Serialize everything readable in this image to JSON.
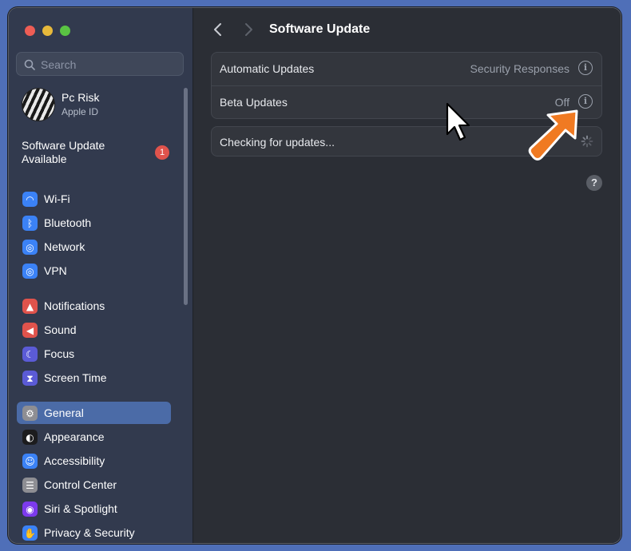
{
  "sidebar": {
    "search": {
      "placeholder": "Search"
    },
    "profile": {
      "name": "Pc Risk",
      "subtitle": "Apple ID"
    },
    "software_update": {
      "line1": "Software Update",
      "line2": "Available",
      "badge": "1"
    },
    "items": [
      {
        "label": "Wi-Fi",
        "icon": "wifi-icon",
        "color": "#3b82f6"
      },
      {
        "label": "Bluetooth",
        "icon": "bluetooth-icon",
        "color": "#3b82f6"
      },
      {
        "label": "Network",
        "icon": "globe-icon",
        "color": "#3b82f6"
      },
      {
        "label": "VPN",
        "icon": "globe-icon",
        "color": "#3b82f6"
      },
      {
        "label": "Notifications",
        "icon": "bell-icon",
        "color": "#e0534c"
      },
      {
        "label": "Sound",
        "icon": "speaker-icon",
        "color": "#e0534c"
      },
      {
        "label": "Focus",
        "icon": "moon-icon",
        "color": "#5b5bd6"
      },
      {
        "label": "Screen Time",
        "icon": "hourglass-icon",
        "color": "#5b5bd6"
      },
      {
        "label": "General",
        "icon": "gear-icon",
        "color": "#8e8e93",
        "selected": true
      },
      {
        "label": "Appearance",
        "icon": "appearance-icon",
        "color": "#1c1c1e"
      },
      {
        "label": "Accessibility",
        "icon": "accessibility-icon",
        "color": "#3b82f6"
      },
      {
        "label": "Control Center",
        "icon": "toggles-icon",
        "color": "#8e8e93"
      },
      {
        "label": "Siri & Spotlight",
        "icon": "siri-icon",
        "color": "#7c3aed"
      },
      {
        "label": "Privacy & Security",
        "icon": "hand-icon",
        "color": "#3b82f6"
      }
    ]
  },
  "main": {
    "title": "Software Update",
    "rows": [
      {
        "label": "Automatic Updates",
        "value": "Security Responses"
      },
      {
        "label": "Beta Updates",
        "value": "Off"
      }
    ],
    "info_glyph": "i",
    "checking": "Checking for updates...",
    "help": "?"
  }
}
